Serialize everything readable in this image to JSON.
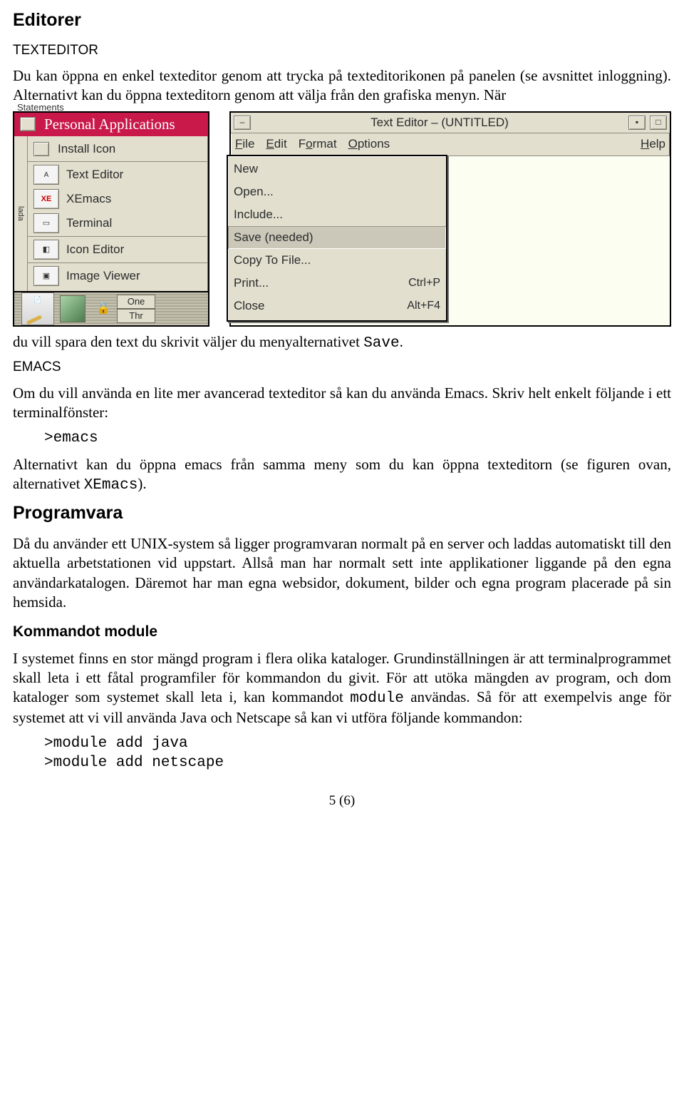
{
  "headings": {
    "editorer": "Editorer",
    "programvara": "Programvara",
    "module": "Kommandot module"
  },
  "subtitles": {
    "texteditor": "TEXTEDITOR",
    "emacs": "EMACS"
  },
  "paragraphs": {
    "p1": "Du kan öppna en enkel texteditor genom att trycka på texteditorikonen på panelen (se avsnittet inloggning). Alternativt kan du öppna texteditorn genom att välja från den grafiska menyn. När",
    "p2a": "du vill spara den text du skrivit väljer du menyalternativet ",
    "p2_code": "Save",
    "p2b": ".",
    "p3": "Om du vill använda en lite mer avancerad texteditor så kan du använda Emacs. Skriv helt enkelt följande i ett terminalfönster:",
    "p4a": "Alternativt kan du öppna emacs från samma meny som du kan öppna texteditorn (se figuren ovan, alternativet ",
    "p4_code": "XEmacs",
    "p4b": ").",
    "p5": "Då du använder ett UNIX-system så ligger programvaran normalt på en server och laddas automatiskt till den aktuella arbetstationen vid uppstart. Allså man har normalt sett inte applikationer liggande på den egna användarkatalogen. Däremot har man egna websidor, dokument, bilder och egna program placerade på sin hemsida.",
    "p6a": "I systemet finns en stor mängd program i flera olika kataloger. Grundinställningen är att terminalprogrammet skall leta i ett fåtal programfiler för kommandon du givit. För att utöka mängden av program, och dom kataloger som systemet skall leta i, kan kommandot ",
    "p6_code": "module",
    "p6b": " användas. Så för att exempelvis ange för systemet att vi vill använda Java och Netscape så kan vi utföra följande kommandon:"
  },
  "codes": {
    "emacs": ">emacs",
    "mod1": ">module add java",
    "mod2": ">module add netscape"
  },
  "fig_left": {
    "top_caption": "Statements",
    "panel_title": "Personal Applications",
    "items": [
      "Install Icon",
      "Text Editor",
      "XEmacs",
      "Terminal",
      "Icon Editor",
      "Image Viewer"
    ],
    "item_badge": "XE",
    "gutter_label": "lada",
    "dock_chips": [
      "One",
      "Thr"
    ]
  },
  "fig_right": {
    "window_title": "Text Editor – (UNTITLED)",
    "menubar": {
      "file": "File",
      "edit": "Edit",
      "format": "Format",
      "options": "Options",
      "help": "Help"
    },
    "filemenu": [
      {
        "label": "New",
        "shortcut": ""
      },
      {
        "label": "Open...",
        "shortcut": ""
      },
      {
        "label": "Include...",
        "shortcut": ""
      },
      {
        "label": "Save (needed)",
        "shortcut": "",
        "selected": true
      },
      {
        "label": "Copy To File...",
        "shortcut": ""
      },
      {
        "label": "Print...",
        "shortcut": "Ctrl+P"
      },
      {
        "label": "Close",
        "shortcut": "Alt+F4"
      }
    ]
  },
  "page_num": "5 (6)"
}
